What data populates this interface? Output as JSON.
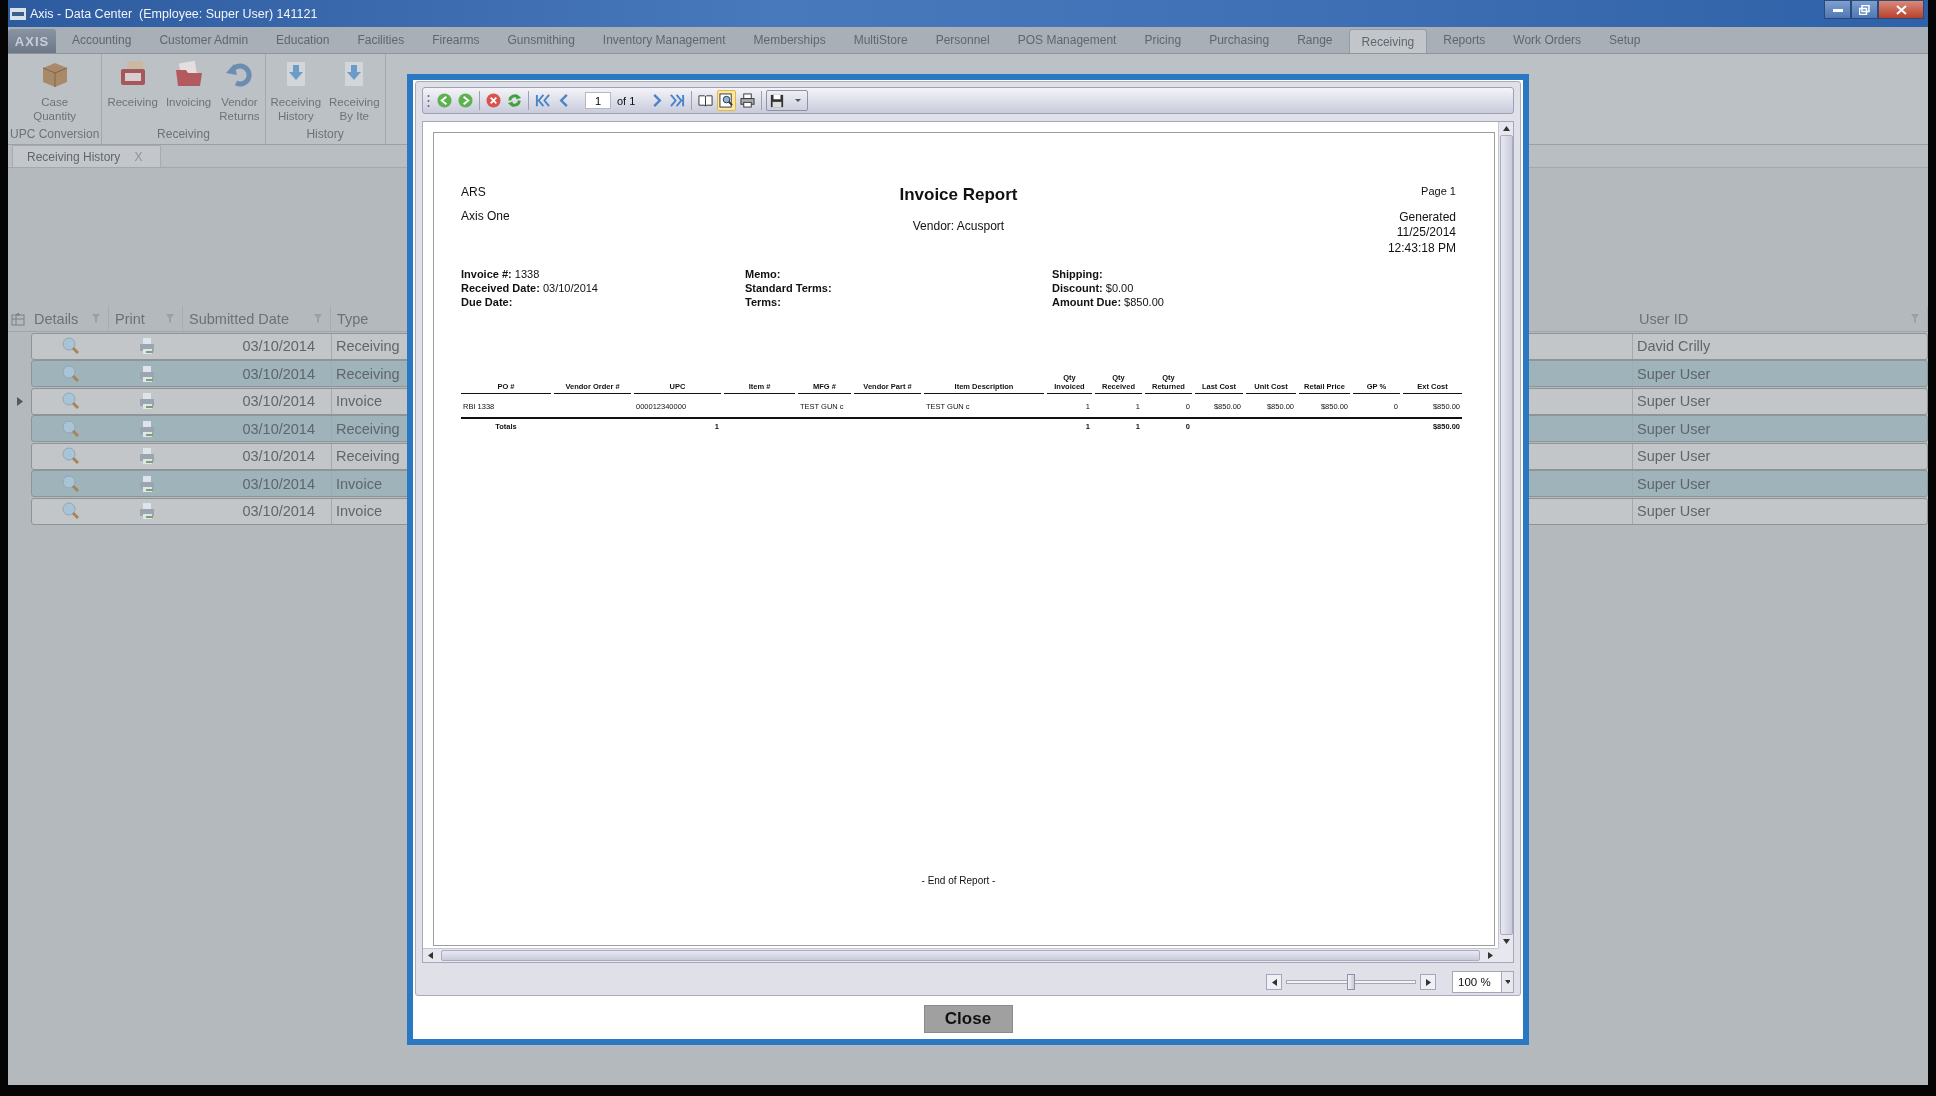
{
  "window": {
    "title": "Axis - Data Center  (Employee: Super User) 141121",
    "app_button": "AXIS"
  },
  "menu_tabs": [
    {
      "label": "Accounting",
      "selected": false
    },
    {
      "label": "Customer Admin",
      "selected": false
    },
    {
      "label": "Education",
      "selected": false
    },
    {
      "label": "Facilities",
      "selected": false
    },
    {
      "label": "Firearms",
      "selected": false
    },
    {
      "label": "Gunsmithing",
      "selected": false
    },
    {
      "label": "Inventory Management",
      "selected": false
    },
    {
      "label": "Memberships",
      "selected": false
    },
    {
      "label": "MultiStore",
      "selected": false
    },
    {
      "label": "Personnel",
      "selected": false
    },
    {
      "label": "POS Management",
      "selected": false
    },
    {
      "label": "Pricing",
      "selected": false
    },
    {
      "label": "Purchasing",
      "selected": false
    },
    {
      "label": "Range",
      "selected": false
    },
    {
      "label": "Receiving",
      "selected": true
    },
    {
      "label": "Reports",
      "selected": false
    },
    {
      "label": "Work Orders",
      "selected": false
    },
    {
      "label": "Setup",
      "selected": false
    }
  ],
  "ribbon_groups": [
    {
      "label": "UPC Conversion",
      "buttons": [
        {
          "kind": "crate",
          "lines": [
            "Case",
            "Quantity"
          ]
        }
      ]
    },
    {
      "label": "Receiving",
      "buttons": [
        {
          "kind": "po",
          "lines": [
            "Receiving"
          ]
        },
        {
          "kind": "folder",
          "lines": [
            "Invoicing"
          ]
        },
        {
          "kind": "return",
          "lines": [
            "Vendor",
            "Returns"
          ]
        }
      ]
    },
    {
      "label": "History",
      "buttons": [
        {
          "kind": "download",
          "lines": [
            "Receiving",
            "History"
          ]
        },
        {
          "kind": "download",
          "lines": [
            "Receiving",
            "By Ite"
          ]
        }
      ]
    }
  ],
  "document_tabs": [
    {
      "label": "Receiving History",
      "close": "X",
      "selected": true
    }
  ],
  "grid": {
    "columns": [
      {
        "label": "Details"
      },
      {
        "label": "Print"
      },
      {
        "label": "Submitted Date"
      },
      {
        "label": "Type"
      },
      {
        "label": "User ID"
      }
    ],
    "rows": [
      {
        "date": "03/10/2014",
        "type": "Receiving",
        "user_id": "David Crilly",
        "selected": false,
        "current": false
      },
      {
        "date": "03/10/2014",
        "type": "Receiving",
        "user_id": "Super User",
        "selected": true,
        "current": false
      },
      {
        "date": "03/10/2014",
        "type": "Invoice",
        "user_id": "Super User",
        "selected": false,
        "current": true
      },
      {
        "date": "03/10/2014",
        "type": "Receiving",
        "user_id": "Super User",
        "selected": true,
        "current": false
      },
      {
        "date": "03/10/2014",
        "type": "Receiving",
        "user_id": "Super User",
        "selected": false,
        "current": false
      },
      {
        "date": "03/10/2014",
        "type": "Invoice",
        "user_id": "Super User",
        "selected": true,
        "current": false
      },
      {
        "date": "03/10/2014",
        "type": "Invoice",
        "user_id": "Super User",
        "selected": false,
        "current": false
      }
    ]
  },
  "dialog": {
    "toolbar": [
      {
        "kind": "back",
        "on": false
      },
      {
        "kind": "forward",
        "on": false
      },
      {
        "kind": "separator"
      },
      {
        "kind": "stop",
        "on": false
      },
      {
        "kind": "refresh",
        "on": false
      },
      {
        "kind": "separator"
      },
      {
        "kind": "first",
        "on": false
      },
      {
        "kind": "prev",
        "on": false
      },
      {
        "kind": "page",
        "value": "1",
        "suffix": "of 1"
      },
      {
        "kind": "next",
        "on": false
      },
      {
        "kind": "last",
        "on": false
      },
      {
        "kind": "separator"
      },
      {
        "kind": "book",
        "on": false
      },
      {
        "kind": "search",
        "on": true
      },
      {
        "kind": "print",
        "on": false
      },
      {
        "kind": "separator"
      },
      {
        "kind": "save",
        "on": false
      }
    ],
    "report": {
      "company": "ARS",
      "location": "Axis One",
      "title": "Invoice Report",
      "vendor": "Vendor: Acusport",
      "page": "Page 1",
      "generated_label": "Generated",
      "generated_date": "11/25/2014",
      "generated_time": "12:43:18 PM",
      "fields": [
        [
          {
            "label": "Invoice #:",
            "value": "1338"
          },
          {
            "label": "Received Date:",
            "value": "03/10/2014"
          },
          {
            "label": "Due Date:"
          }
        ],
        [
          {
            "label": "Memo:"
          },
          {
            "label": "Standard Terms:"
          },
          {
            "label": "Terms:"
          }
        ],
        [
          {
            "label": "Shipping:"
          },
          {
            "label": "Discount:",
            "value": "$0.00"
          },
          {
            "label": "Amount Due:",
            "value": "$850.00"
          }
        ]
      ],
      "columns": [
        {
          "label": "PO #",
          "cell": "RBI 1338",
          "total": "Totals"
        },
        {
          "label": "Vendor Order #"
        },
        {
          "label": "UPC",
          "cell": "000012340000",
          "total": "1"
        },
        {
          "label": "Item #"
        },
        {
          "label": "MFG #",
          "cell": "TEST GUN c"
        },
        {
          "label": "Vendor  Part #"
        },
        {
          "label": "Item Description",
          "cell": "TEST GUN c"
        },
        {
          "label": "Qty\nInvoiced",
          "cell": "1",
          "total": "1"
        },
        {
          "label": "Qty\nReceived",
          "cell": "1",
          "total": "1"
        },
        {
          "label": "Qty\nReturned",
          "cell": "0",
          "total": "0"
        },
        {
          "label": "Last Cost",
          "cell": "$850.00"
        },
        {
          "label": "Unit Cost",
          "cell": "$850.00"
        },
        {
          "label": "Retail Price",
          "cell": "$850.00"
        },
        {
          "label": "GP %",
          "cell": "0"
        },
        {
          "label": "Ext Cost",
          "cell": "$850.00",
          "total": "$850.00"
        }
      ],
      "footer": "- End of Report -"
    },
    "zoom": {
      "level": 0.5,
      "value": "100 %"
    },
    "close_button": "Close"
  }
}
